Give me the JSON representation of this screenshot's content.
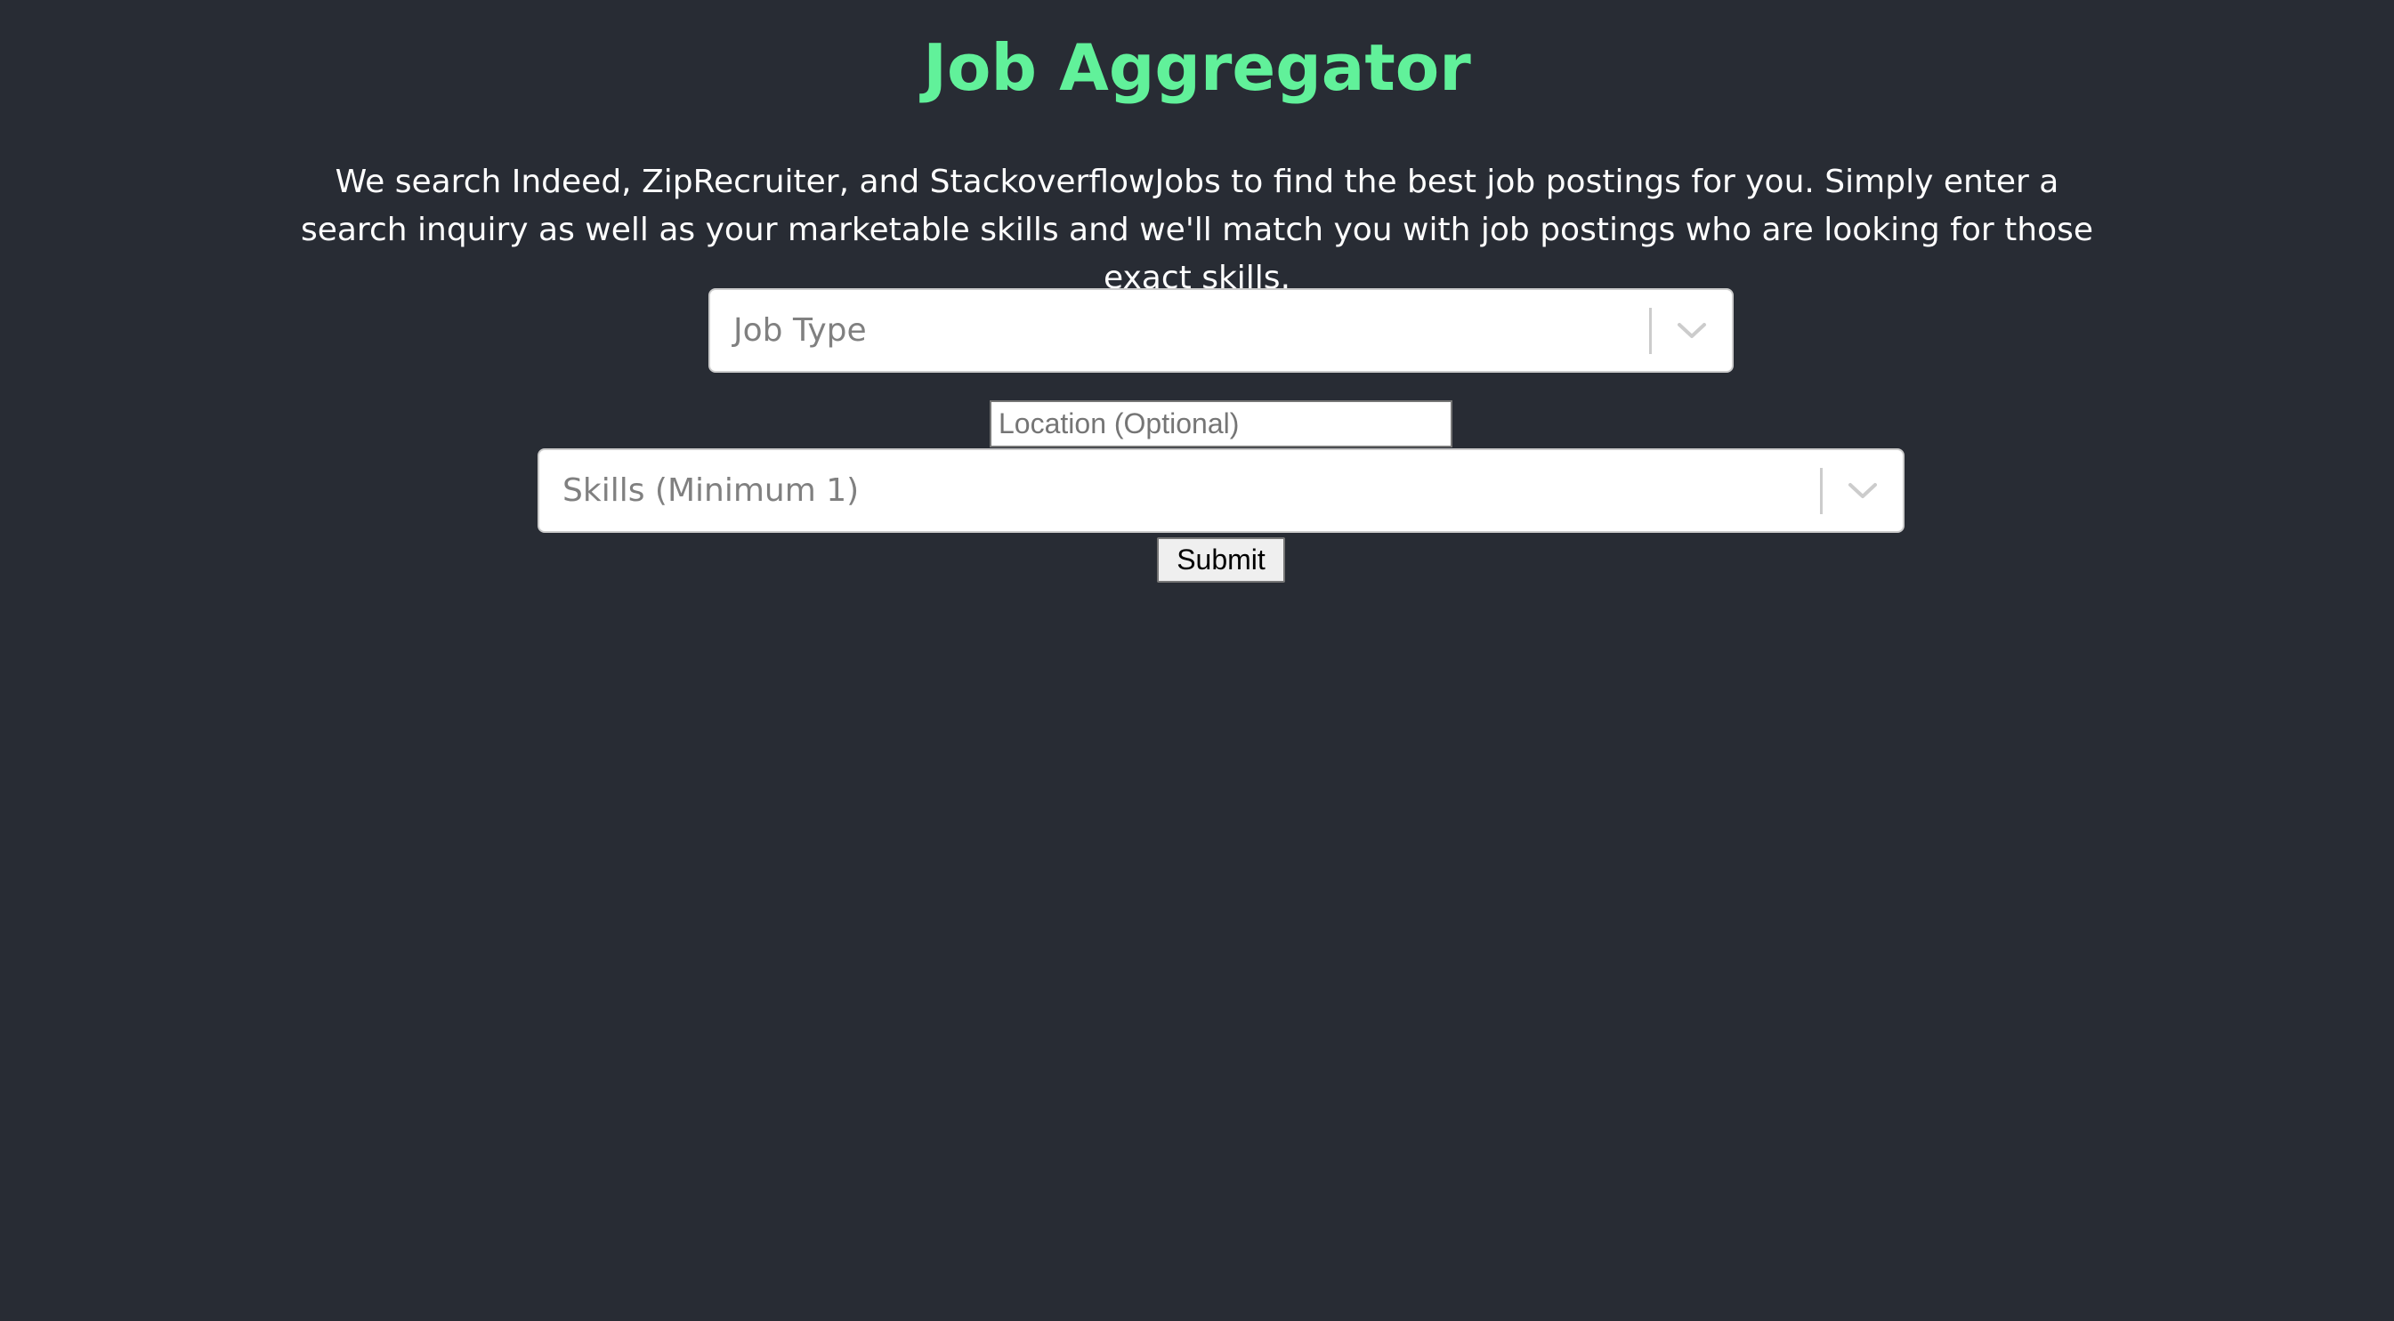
{
  "header": {
    "title": "Job Aggregator",
    "description": "We search Indeed, ZipRecruiter, and StackoverflowJobs to find the best job postings for you. Simply enter a search inquiry as well as your marketable skills and we'll match you with job postings who are looking for those exact skills."
  },
  "form": {
    "job_type": {
      "placeholder": "Job Type",
      "value": "",
      "icon": "chevron-down-icon"
    },
    "location": {
      "placeholder": "Location (Optional)",
      "value": ""
    },
    "skills": {
      "placeholder": "Skills (Minimum 1)",
      "value": "",
      "icon": "chevron-down-icon"
    },
    "submit_label": "Submit"
  },
  "colors": {
    "background": "#282c34",
    "title": "#61f19a",
    "text": "#ffffff"
  }
}
